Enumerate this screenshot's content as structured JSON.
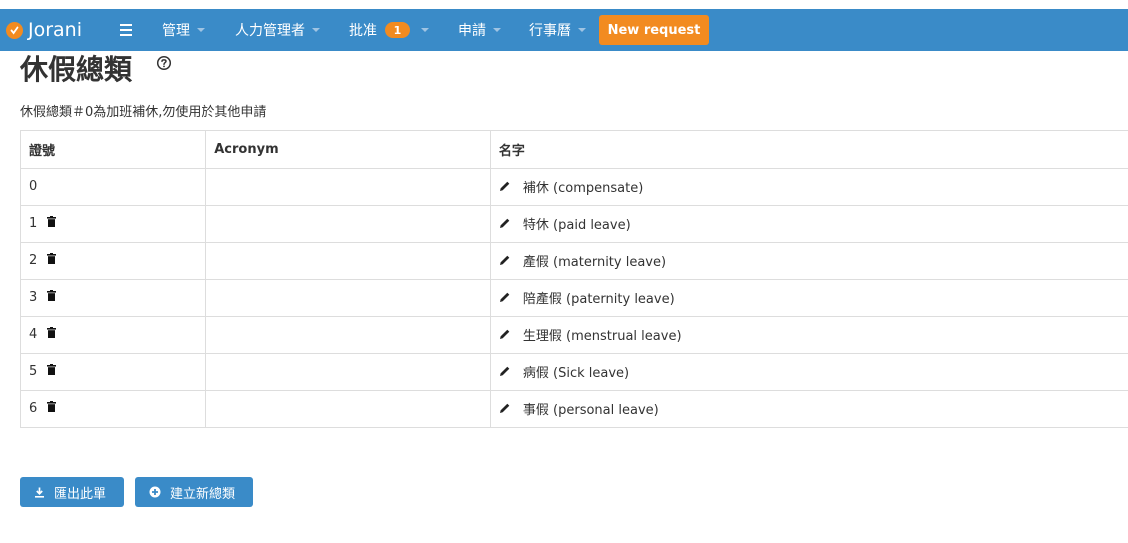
{
  "navbar": {
    "brand": "Jorani",
    "items": [
      {
        "label": "管理"
      },
      {
        "label": "人力管理者"
      },
      {
        "label": "批准",
        "badge": "1"
      },
      {
        "label": "申請"
      },
      {
        "label": "行事曆"
      }
    ],
    "new_request": "New request"
  },
  "page": {
    "title": "休假總類",
    "notice": "休假總類＃0為加班補休,勿使用於其他申請"
  },
  "table": {
    "headers": [
      "證號",
      "Acronym",
      "名字"
    ],
    "rows": [
      {
        "id": "0",
        "acronym": "",
        "name": "補休 (compensate)"
      },
      {
        "id": "1",
        "acronym": "",
        "name": "特休 (paid leave)"
      },
      {
        "id": "2",
        "acronym": "",
        "name": "產假 (maternity leave)"
      },
      {
        "id": "3",
        "acronym": "",
        "name": "陪產假 (paternity leave)"
      },
      {
        "id": "4",
        "acronym": "",
        "name": "生理假 (menstrual leave)"
      },
      {
        "id": "5",
        "acronym": "",
        "name": "病假 (Sick leave)"
      },
      {
        "id": "6",
        "acronym": "",
        "name": "事假 (personal leave)"
      }
    ]
  },
  "buttons": {
    "export": "匯出此單",
    "create": "建立新總類"
  },
  "colors": {
    "navbar": "#3a8bc8",
    "accent": "#f28b20",
    "button": "#3a8bc8"
  }
}
